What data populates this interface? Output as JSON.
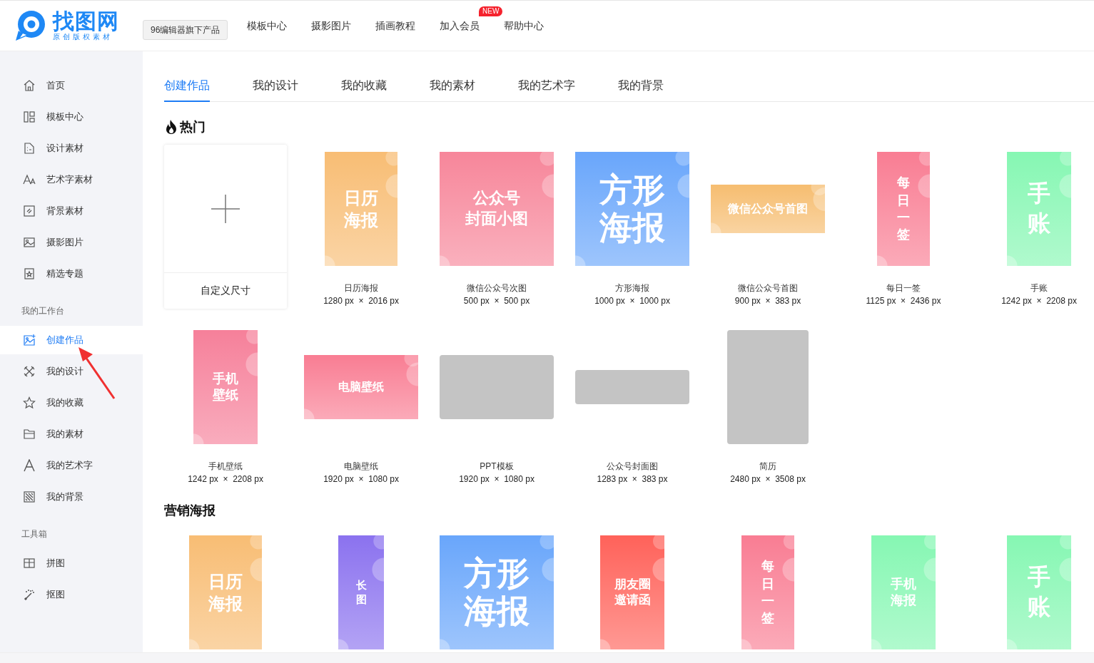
{
  "header": {
    "logo": {
      "name": "找图网",
      "tagline": "原创版权素材"
    },
    "product_button": "96编辑器旗下产品",
    "nav": [
      {
        "label": "模板中心"
      },
      {
        "label": "摄影图片"
      },
      {
        "label": "插画教程"
      },
      {
        "label": "加入会员",
        "badge": "NEW"
      },
      {
        "label": "帮助中心"
      }
    ]
  },
  "sidebar": {
    "sections": [
      {
        "items": [
          {
            "label": "首页",
            "selected": false
          },
          {
            "label": "模板中心",
            "selected": false
          },
          {
            "label": "设计素材",
            "selected": false
          },
          {
            "label": "艺术字素材",
            "selected": false
          },
          {
            "label": "背景素材",
            "selected": false
          },
          {
            "label": "摄影图片",
            "selected": false
          },
          {
            "label": "精选专题",
            "selected": false
          }
        ]
      },
      {
        "heading": "我的工作台",
        "items": [
          {
            "label": "创建作品",
            "selected": true
          },
          {
            "label": "我的设计",
            "selected": false
          },
          {
            "label": "我的收藏",
            "selected": false
          },
          {
            "label": "我的素材",
            "selected": false
          },
          {
            "label": "我的艺术字",
            "selected": false
          },
          {
            "label": "我的背景",
            "selected": false
          }
        ]
      },
      {
        "heading": "工具箱",
        "items": [
          {
            "label": "拼图",
            "selected": false
          },
          {
            "label": "抠图",
            "selected": false
          }
        ]
      }
    ]
  },
  "tabs": [
    {
      "label": "创建作品",
      "selected": true
    },
    {
      "label": "我的设计",
      "selected": false
    },
    {
      "label": "我的收藏",
      "selected": false
    },
    {
      "label": "我的素材",
      "selected": false
    },
    {
      "label": "我的艺术字",
      "selected": false
    },
    {
      "label": "我的背景",
      "selected": false
    }
  ],
  "sections": [
    {
      "title": "热门",
      "hot": true,
      "items": [
        {
          "kind": "custom",
          "name": "自定义尺寸"
        },
        {
          "kind": "portrait",
          "color": "#f8bd74",
          "thumb_text": [
            "日历",
            "海报"
          ],
          "name": "日历海报",
          "size": "1280 px  ×  2016 px"
        },
        {
          "kind": "square",
          "color": "#f7869a",
          "thumb_text": [
            "公众号",
            "封面小图"
          ],
          "name": "微信公众号次图",
          "size": "500 px  ×  500 px"
        },
        {
          "kind": "square",
          "color": "#69a6fb",
          "thumb_text": [
            "方形",
            "海报"
          ],
          "name": "方形海报",
          "size": "1000 px  ×  1000 px"
        },
        {
          "kind": "wide",
          "color": "#f6bd70",
          "thumb_text": [
            "微信公众号首图"
          ],
          "name": "微信公众号首图",
          "size": "900 px  ×  383 px"
        },
        {
          "kind": "slim",
          "color": "#f97d93",
          "thumb_text": [
            "每",
            "日",
            "一",
            "签"
          ],
          "name": "每日一签",
          "size": "1125 px  ×  2436 px"
        },
        {
          "kind": "narrow",
          "color": "#86f7b3",
          "thumb_text": [
            "手",
            "账"
          ],
          "name": "手账",
          "size": "1242 px  ×  2208 px"
        },
        {
          "kind": "narrow",
          "color": "#f6809a",
          "thumb_text": [
            "手机",
            "壁纸"
          ],
          "name": "手机壁纸",
          "size": "1242 px  ×  2208 px"
        },
        {
          "kind": "landscape",
          "color": "#f97d93",
          "thumb_text": [
            "电脑壁纸"
          ],
          "name": "电脑壁纸",
          "size": "1920 px  ×  1080 px"
        },
        {
          "kind": "landscape",
          "color": "#c4c4c4",
          "name": "PPT模板",
          "size": "1920 px  ×  1080 px"
        },
        {
          "kind": "banner",
          "color": "#c4c4c4",
          "name": "公众号封面图",
          "size": "1283 px  ×  383 px"
        },
        {
          "kind": "a4",
          "color": "#c4c4c4",
          "name": "简历",
          "size": "2480 px  ×  3508 px"
        }
      ]
    },
    {
      "title": "营销海报",
      "hot": false,
      "items": [
        {
          "kind": "portrait",
          "color": "#f8bd74",
          "thumb_text": [
            "日历",
            "海报"
          ]
        },
        {
          "kind": "long",
          "color": "#8b72ef",
          "thumb_text": [
            "长",
            "图"
          ]
        },
        {
          "kind": "square",
          "color": "#69a6fb",
          "thumb_text": [
            "方形",
            "海报"
          ]
        },
        {
          "kind": "narrow",
          "color": "#ff625a",
          "thumb_text": [
            "朋友圈",
            "邀请函"
          ]
        },
        {
          "kind": "slim",
          "color": "#f97d93",
          "thumb_text": [
            "每",
            "日",
            "一",
            "签"
          ]
        },
        {
          "kind": "narrow",
          "color": "#86f7b3",
          "thumb_text": [
            "手机",
            "海报"
          ]
        },
        {
          "kind": "narrow",
          "color": "#86f7b3",
          "thumb_text": [
            "手",
            "账"
          ]
        }
      ]
    }
  ]
}
